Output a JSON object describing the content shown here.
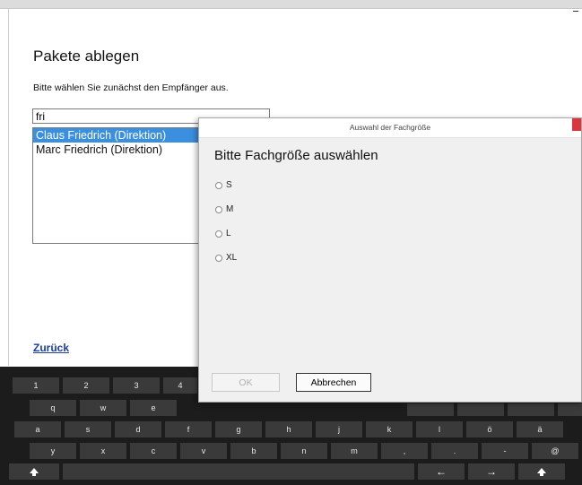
{
  "page": {
    "title": "Pakete ablegen",
    "subtitle": "Bitte wählen Sie zunächst den Empfänger aus.",
    "search_value": "fri",
    "recipients": [
      {
        "label": "Claus Friedrich (Direktion)",
        "selected": true
      },
      {
        "label": "Marc Friedrich (Direktion)",
        "selected": false
      }
    ],
    "back_label": "Zurück"
  },
  "dialog": {
    "title": "Auswahl der Fachgröße",
    "heading": "Bitte Fachgröße auswählen",
    "options": [
      "S",
      "M",
      "L",
      "XL"
    ],
    "ok_label": "OK",
    "cancel_label": "Abbrechen"
  },
  "keyboard": {
    "row1": [
      "1",
      "2",
      "3",
      "4"
    ],
    "row2": [
      "q",
      "w",
      "e"
    ],
    "row3": [
      "a",
      "s",
      "d",
      "f",
      "g",
      "h",
      "j",
      "k",
      "l",
      "ö",
      "ä"
    ],
    "row4": [
      "y",
      "x",
      "c",
      "v",
      "b",
      "n",
      "m",
      ",",
      ".",
      "-",
      "@"
    ]
  },
  "colors": {
    "selection": "#3a8fde",
    "link": "#1a3da8",
    "keyboard_bg": "#1c1c1c",
    "key_bg": "#3a3a3a",
    "close_button": "#d9373f"
  }
}
